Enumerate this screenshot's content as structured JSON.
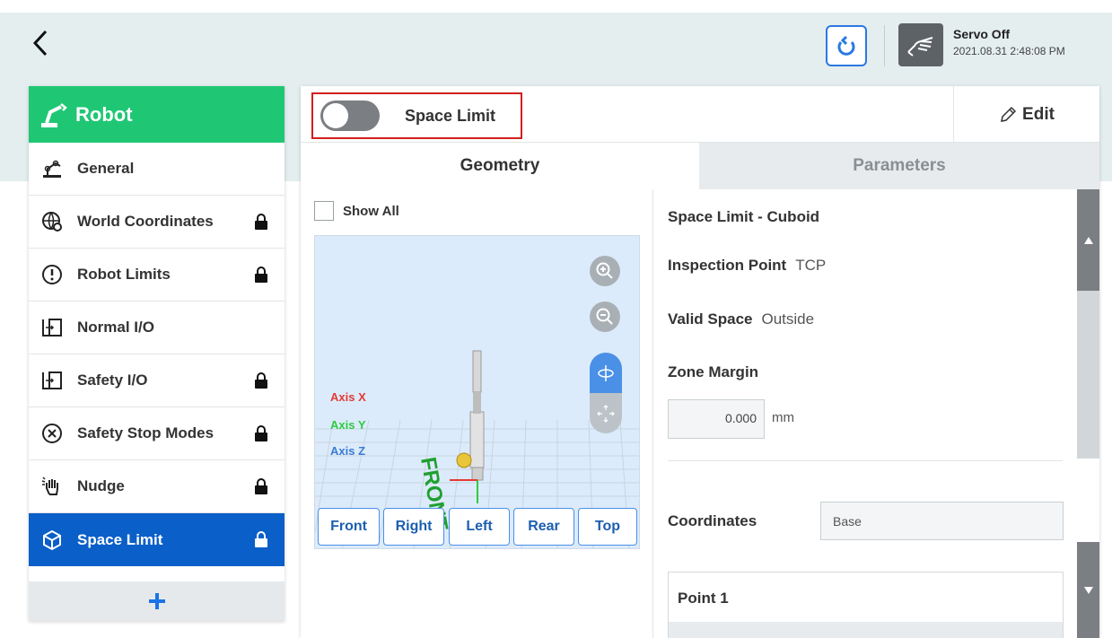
{
  "header": {
    "back_icon": "chevron-left-icon",
    "reset_icon": "power-reset-icon",
    "servo_icon": "hand-icon",
    "servo_status": "Servo Off",
    "timestamp": "2021.08.31 2:48:08 PM",
    "accent_color": "#2b78e4"
  },
  "sidebar": {
    "title": "Robot",
    "title_color": "#1fc774",
    "active_color": "#0a5fc8",
    "items": [
      {
        "label": "General",
        "icon": "robot-arm-icon",
        "locked": false
      },
      {
        "label": "World Coordinates",
        "icon": "globe-gear-icon",
        "locked": true
      },
      {
        "label": "Robot Limits",
        "icon": "limit-icon",
        "locked": true
      },
      {
        "label": "Normal I/O",
        "icon": "io-icon",
        "locked": false
      },
      {
        "label": "Safety I/O",
        "icon": "io-icon",
        "locked": true
      },
      {
        "label": "Safety Stop Modes",
        "icon": "stop-circle-icon",
        "locked": true
      },
      {
        "label": "Nudge",
        "icon": "hand-nudge-icon",
        "locked": true
      },
      {
        "label": "Space Limit",
        "icon": "cube-icon",
        "locked": true,
        "active": true
      }
    ],
    "add_icon": "plus-icon"
  },
  "panel": {
    "toggle_label": "Space Limit",
    "toggle_on": false,
    "edit_label": "Edit",
    "tabs": [
      {
        "label": "Geometry",
        "active": true
      },
      {
        "label": "Parameters",
        "active": false
      }
    ],
    "show_all_label": "Show All",
    "axis_labels": [
      "Axis X",
      "Axis Y",
      "Axis Z"
    ],
    "axis_colors": [
      "#e53935",
      "#2ecc40",
      "#3a7bd5"
    ],
    "front_text": "FRONT",
    "view_buttons": [
      "Front",
      "Right",
      "Left",
      "Rear",
      "Top"
    ],
    "details": {
      "title": "Space Limit - Cuboid",
      "inspection_point_label": "Inspection Point",
      "inspection_point_value": "TCP",
      "valid_space_label": "Valid Space",
      "valid_space_value": "Outside",
      "zone_margin_label": "Zone Margin",
      "zone_margin_value": "0.000",
      "zone_margin_unit": "mm",
      "coordinates_label": "Coordinates",
      "coordinates_value": "Base",
      "point_label": "Point 1"
    }
  }
}
